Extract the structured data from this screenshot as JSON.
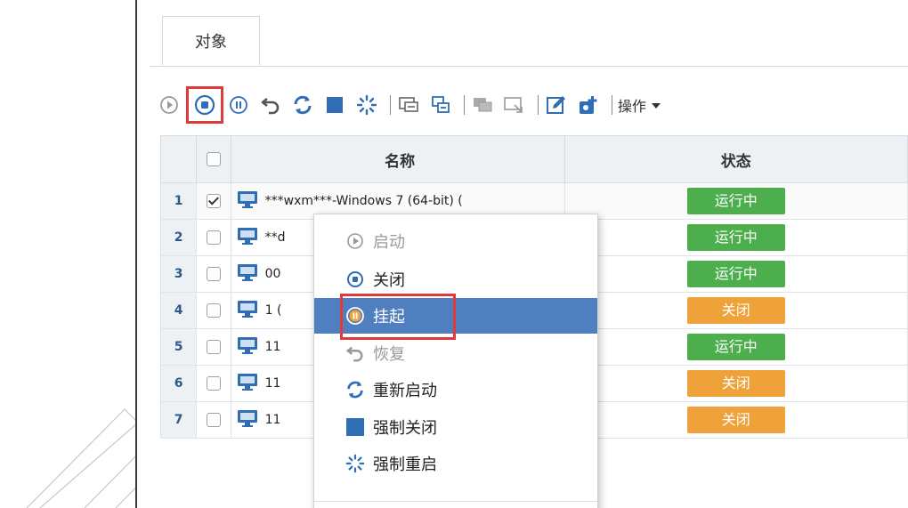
{
  "tab": {
    "label": "对象"
  },
  "toolbar": {
    "icons": [
      "play-icon",
      "stop-icon",
      "pause-icon",
      "undo-icon",
      "refresh-icon",
      "square-icon",
      "spinner-icon",
      "console-icon",
      "migrate-icon",
      "snapshot-icon",
      "screen-icon",
      "edit-icon",
      "add-icon"
    ],
    "ops_label": "操作"
  },
  "table": {
    "headers": {
      "name": "名称",
      "state": "状态"
    },
    "rows": [
      {
        "num": "1",
        "checked": true,
        "name": "***wxm***-Windows 7 (64-bit) (",
        "state": "运行中",
        "color": "#4cae4c"
      },
      {
        "num": "2",
        "checked": false,
        "name": "**d",
        "state": "运行中",
        "color": "#4cae4c"
      },
      {
        "num": "3",
        "checked": false,
        "name": "00",
        "state": "运行中",
        "color": "#4cae4c"
      },
      {
        "num": "4",
        "checked": false,
        "name": "1 (",
        "state": "关闭",
        "color": "#f0a23a"
      },
      {
        "num": "5",
        "checked": false,
        "name": "11",
        "state": "运行中",
        "color": "#4cae4c"
      },
      {
        "num": "6",
        "checked": false,
        "name": "11",
        "state": "关闭",
        "color": "#f0a23a"
      },
      {
        "num": "7",
        "checked": false,
        "name": "11",
        "state": "关闭",
        "color": "#f0a23a"
      }
    ]
  },
  "context_menu": {
    "start": "启动",
    "shutdown": "关闭",
    "suspend": "挂起",
    "resume": "恢复",
    "restart": "重新启动",
    "force_off": "强制关闭",
    "force_restart": "强制重启"
  },
  "colors": {
    "accent": "#4f7fbf",
    "running": "#4cae4c",
    "off": "#f0a23a",
    "highlight": "#e03a3a",
    "icon_blue": "#2f6db5"
  }
}
